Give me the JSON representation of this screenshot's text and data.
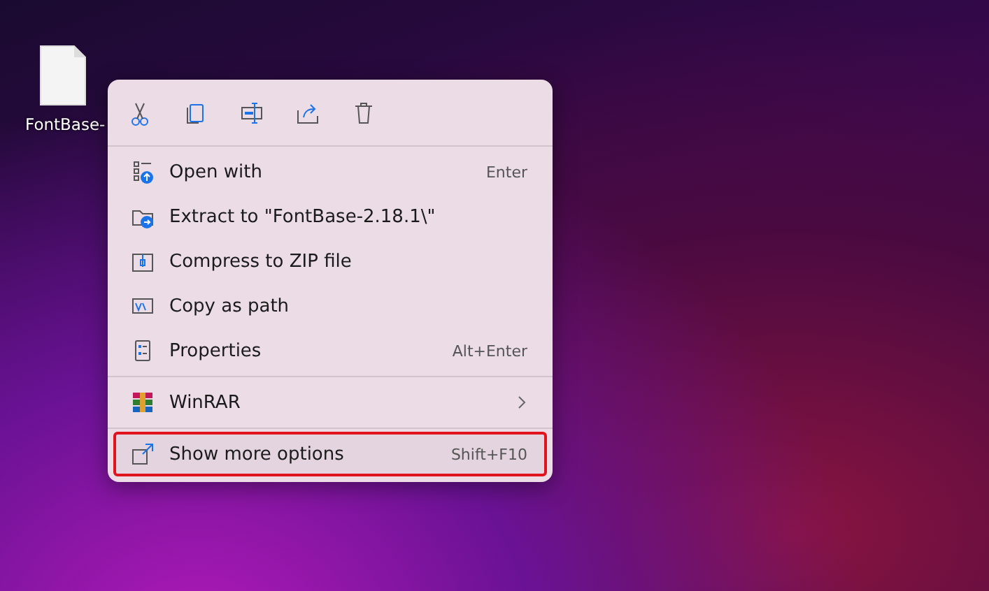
{
  "desktop": {
    "file_label": "FontBase-"
  },
  "context_menu": {
    "groups": [
      [
        {
          "kind": "item",
          "label": "Open with",
          "shortcut": "Enter",
          "highlighted": false
        },
        {
          "kind": "item",
          "label": "Extract to \"FontBase-2.18.1\\\"",
          "highlighted": false
        },
        {
          "kind": "item",
          "label": "Compress to ZIP file",
          "highlighted": false
        },
        {
          "kind": "item",
          "label": "Copy as path",
          "highlighted": false
        },
        {
          "kind": "item",
          "label": "Properties",
          "shortcut": "Alt+Enter",
          "highlighted": false
        }
      ],
      [
        {
          "kind": "submenu",
          "label": "WinRAR",
          "highlighted": false
        }
      ],
      [
        {
          "kind": "item",
          "label": "Show more options",
          "shortcut": "Shift+F10",
          "highlighted": true
        }
      ]
    ]
  }
}
